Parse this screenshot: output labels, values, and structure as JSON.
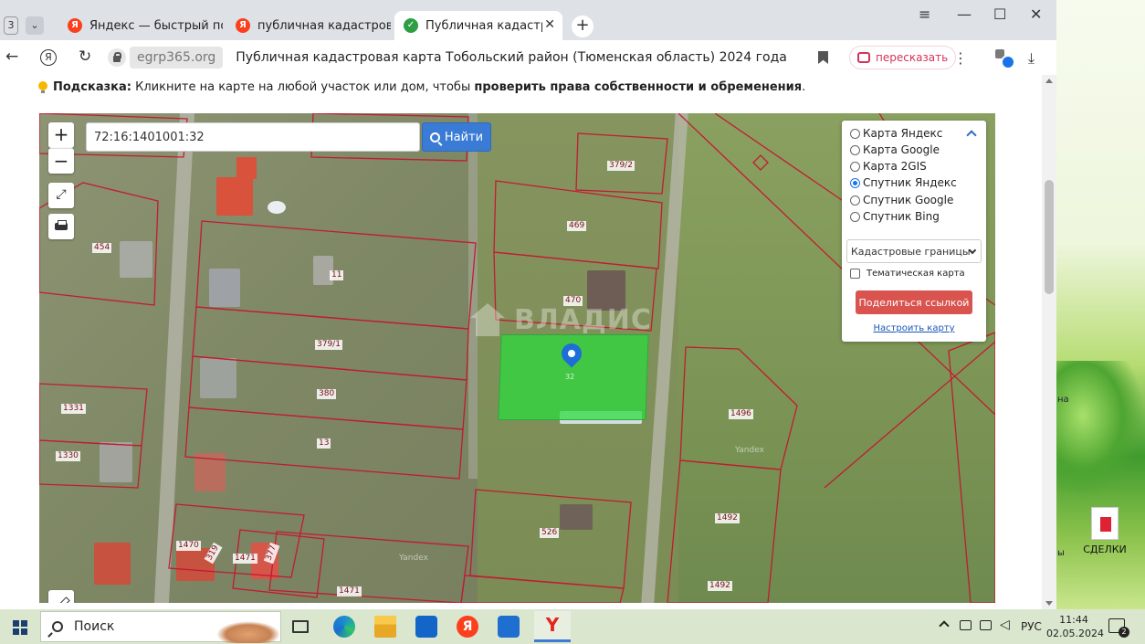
{
  "browser": {
    "tab_count": "3",
    "tabs": [
      {
        "title": "Яндекс — быстрый поиск",
        "favicon": "Я"
      },
      {
        "title": "публичная кадастровая к",
        "favicon": "Я"
      },
      {
        "title": "Публичная кадастровая",
        "favicon": "✓"
      }
    ],
    "address": {
      "domain": "egrp365.org",
      "page_title": "Публичная кадастровая карта Тобольский район (Тюменская область) 2024 года"
    },
    "retell_label": "пересказать"
  },
  "hint": {
    "label": "Подсказка:",
    "text": "Кликните на карте на любой участок или дом, чтобы",
    "bold": "проверить права собственности и обременения",
    "end": "."
  },
  "map": {
    "search_value": "72:16:1401001:32",
    "search_button": "Найти",
    "zoom_in": "+",
    "zoom_out": "−",
    "watermark": "ВЛАДИС",
    "selected_label": "32",
    "parcel_labels": [
      "379/2",
      "469",
      "454",
      "11",
      "470",
      "379/1",
      "380",
      "1331",
      "1330",
      "13",
      "1496",
      "526",
      "1492",
      "1470",
      "319",
      "1471",
      "377",
      "1492",
      "1471"
    ],
    "yandex_marks": [
      "Yandex",
      "Yandex"
    ],
    "layers": {
      "options": [
        "Карта Яндекс",
        "Карта Google",
        "Карта 2GIS",
        "Спутник Яндекс",
        "Спутник Google",
        "Спутник Bing"
      ],
      "selected_index": 3,
      "boundary_select": "Кадастровые границы",
      "thematic_label": "Тематическая карта",
      "share_button": "Поделиться ссылкой",
      "configure_link": "Настроить карту"
    }
  },
  "desktop": {
    "edge_text_a": "на",
    "edge_text_b": "ы",
    "icon_label": "СДЕЛКИ"
  },
  "taskbar": {
    "search_label": "Поиск",
    "ya_label": "Я",
    "yb_label": "Y",
    "lang": "РУС",
    "time": "11:44",
    "date": "02.05.2024",
    "notifications": "2"
  },
  "colors": {
    "parcel_border": "#c8102e",
    "selected_parcel": "#28dc3c",
    "search_button": "#3a7bd5",
    "share_button": "#d9534f"
  }
}
